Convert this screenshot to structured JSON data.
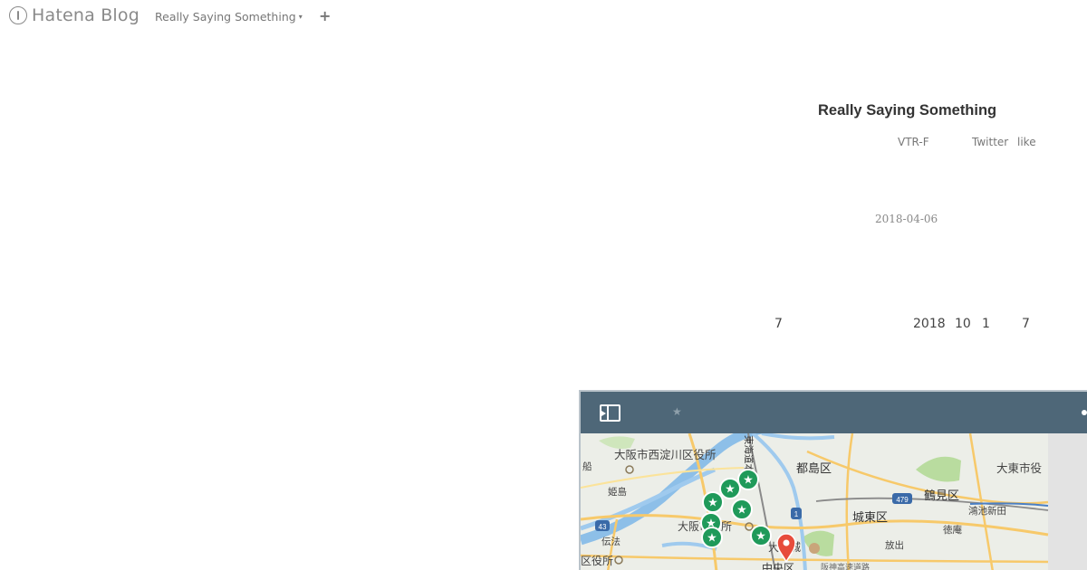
{
  "topbar": {
    "brand": "Hatena Blog",
    "blog_switch": "Really Saying Something",
    "add": "+"
  },
  "header": {
    "title": "Really Saying Something",
    "links": [
      "VTR-F",
      "Twitter",
      "like"
    ],
    "date": "2018-04-06"
  },
  "content": {
    "numbers": [
      "7",
      "2018",
      "10",
      "1",
      "7"
    ]
  },
  "map": {
    "labels": {
      "nishiyodogawa": "大阪市西淀川区役所",
      "miyakojima": "都島区",
      "daito": "大東市役",
      "tsurumi": "鶴見区",
      "joto": "城東区",
      "himeshima": "姫島",
      "nodacity": "大阪市役所",
      "denpo": "伝法",
      "kounoike": "鴻池新田",
      "tokuan": "徳庵",
      "hanaten": "放出",
      "osakajo": "大阪城",
      "chuo": "中央区",
      "yakusho": "区役所",
      "fune": "船",
      "route43": "43",
      "route479": "479",
      "route1": "1",
      "rail1": "東海道本線",
      "rail2": "阪神高速道路"
    },
    "colors": {
      "toolbar": "#4e6778",
      "marker_green": "#1f9a5a",
      "marker_red": "#e74c3c",
      "river": "#8dbfe8",
      "park": "#b9dc9f"
    }
  }
}
